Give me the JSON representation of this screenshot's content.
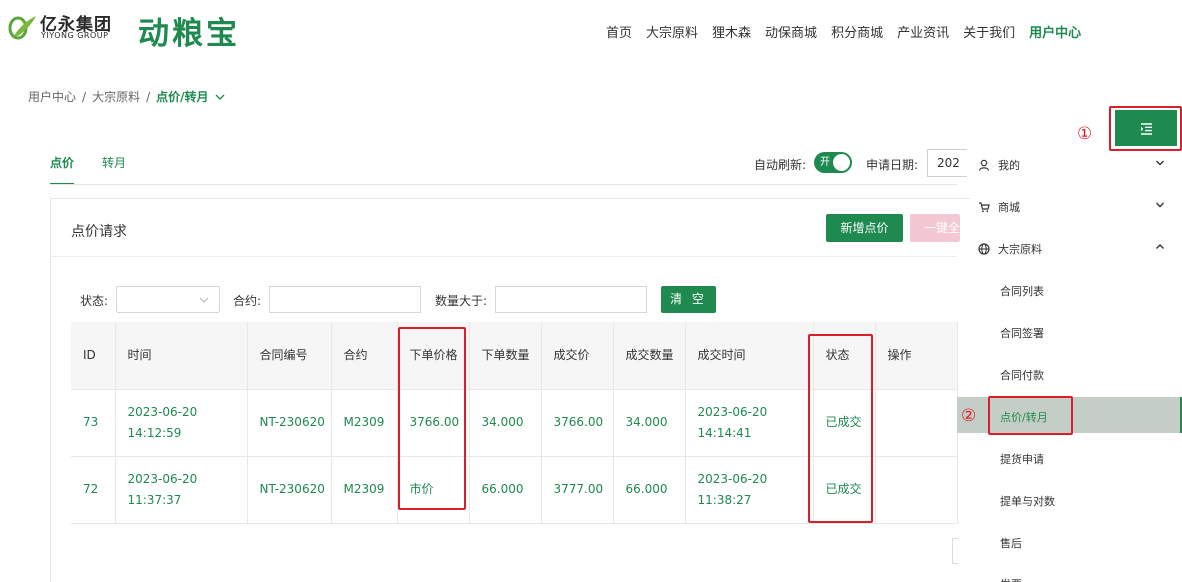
{
  "header": {
    "logo_cn": "亿永集团",
    "logo_en": "YIYONG GROUP",
    "brand": "动粮宝",
    "nav": [
      "首页",
      "大宗原料",
      "狸木森",
      "动保商城",
      "积分商城",
      "产业资讯",
      "关于我们",
      "用户中心"
    ]
  },
  "breadcrumb": {
    "items": [
      "用户中心",
      "大宗原料",
      "点价/转月"
    ],
    "sep": "/"
  },
  "tabs": [
    "点价",
    "转月"
  ],
  "toolbar": {
    "auto_refresh": "自动刷新:",
    "toggle": "开",
    "date_label": "申请日期:",
    "date_value": "202"
  },
  "panel": {
    "title": "点价请求",
    "add_button": "新增点价",
    "batch_button": "一键全",
    "filters": {
      "status_label": "状态:",
      "contract_label": "合约:",
      "qty_label": "数量大于:",
      "clear_button": "清 空"
    }
  },
  "table": {
    "headers": [
      "ID",
      "时间",
      "合同编号",
      "合约",
      "下单价格",
      "下单数量",
      "成交价",
      "成交数量",
      "成交时间",
      "状态",
      "操作"
    ],
    "rows": [
      {
        "id": "73",
        "time": "2023-06-20 14:12:59",
        "contract_no": "NT-230620",
        "contract": "M2309",
        "order_price": "3766.00",
        "order_qty": "34.000",
        "deal_price": "3766.00",
        "deal_qty": "34.000",
        "deal_time": "2023-06-20 14:14:41",
        "status": "已成交",
        "op": ""
      },
      {
        "id": "72",
        "time": "2023-06-20 11:37:37",
        "contract_no": "NT-230620",
        "contract": "M2309",
        "order_price": "市价",
        "order_qty": "66.000",
        "deal_price": "3777.00",
        "deal_qty": "66.000",
        "deal_time": "2023-06-20 11:38:27",
        "status": "已成交",
        "op": ""
      }
    ]
  },
  "sidebar": {
    "menu_icon": "menu-indent-icon",
    "annotation_1": "①",
    "annotation_2": "②",
    "groups": [
      {
        "label": "我的",
        "icon": "user-icon",
        "expanded": false
      },
      {
        "label": "商城",
        "icon": "cart-icon",
        "expanded": false
      },
      {
        "label": "大宗原料",
        "icon": "globe-icon",
        "expanded": true
      }
    ],
    "subitems": [
      "合同列表",
      "合同签署",
      "合同付款",
      "点价/转月",
      "提货申请",
      "提单与对数",
      "售后",
      "发票"
    ],
    "active_sub": "点价/转月"
  },
  "colors": {
    "accent": "#1e8a4f",
    "highlight": "#d9202a",
    "batch_disabled": "#f3c8d3",
    "active_bg": "#c5cdc7"
  }
}
